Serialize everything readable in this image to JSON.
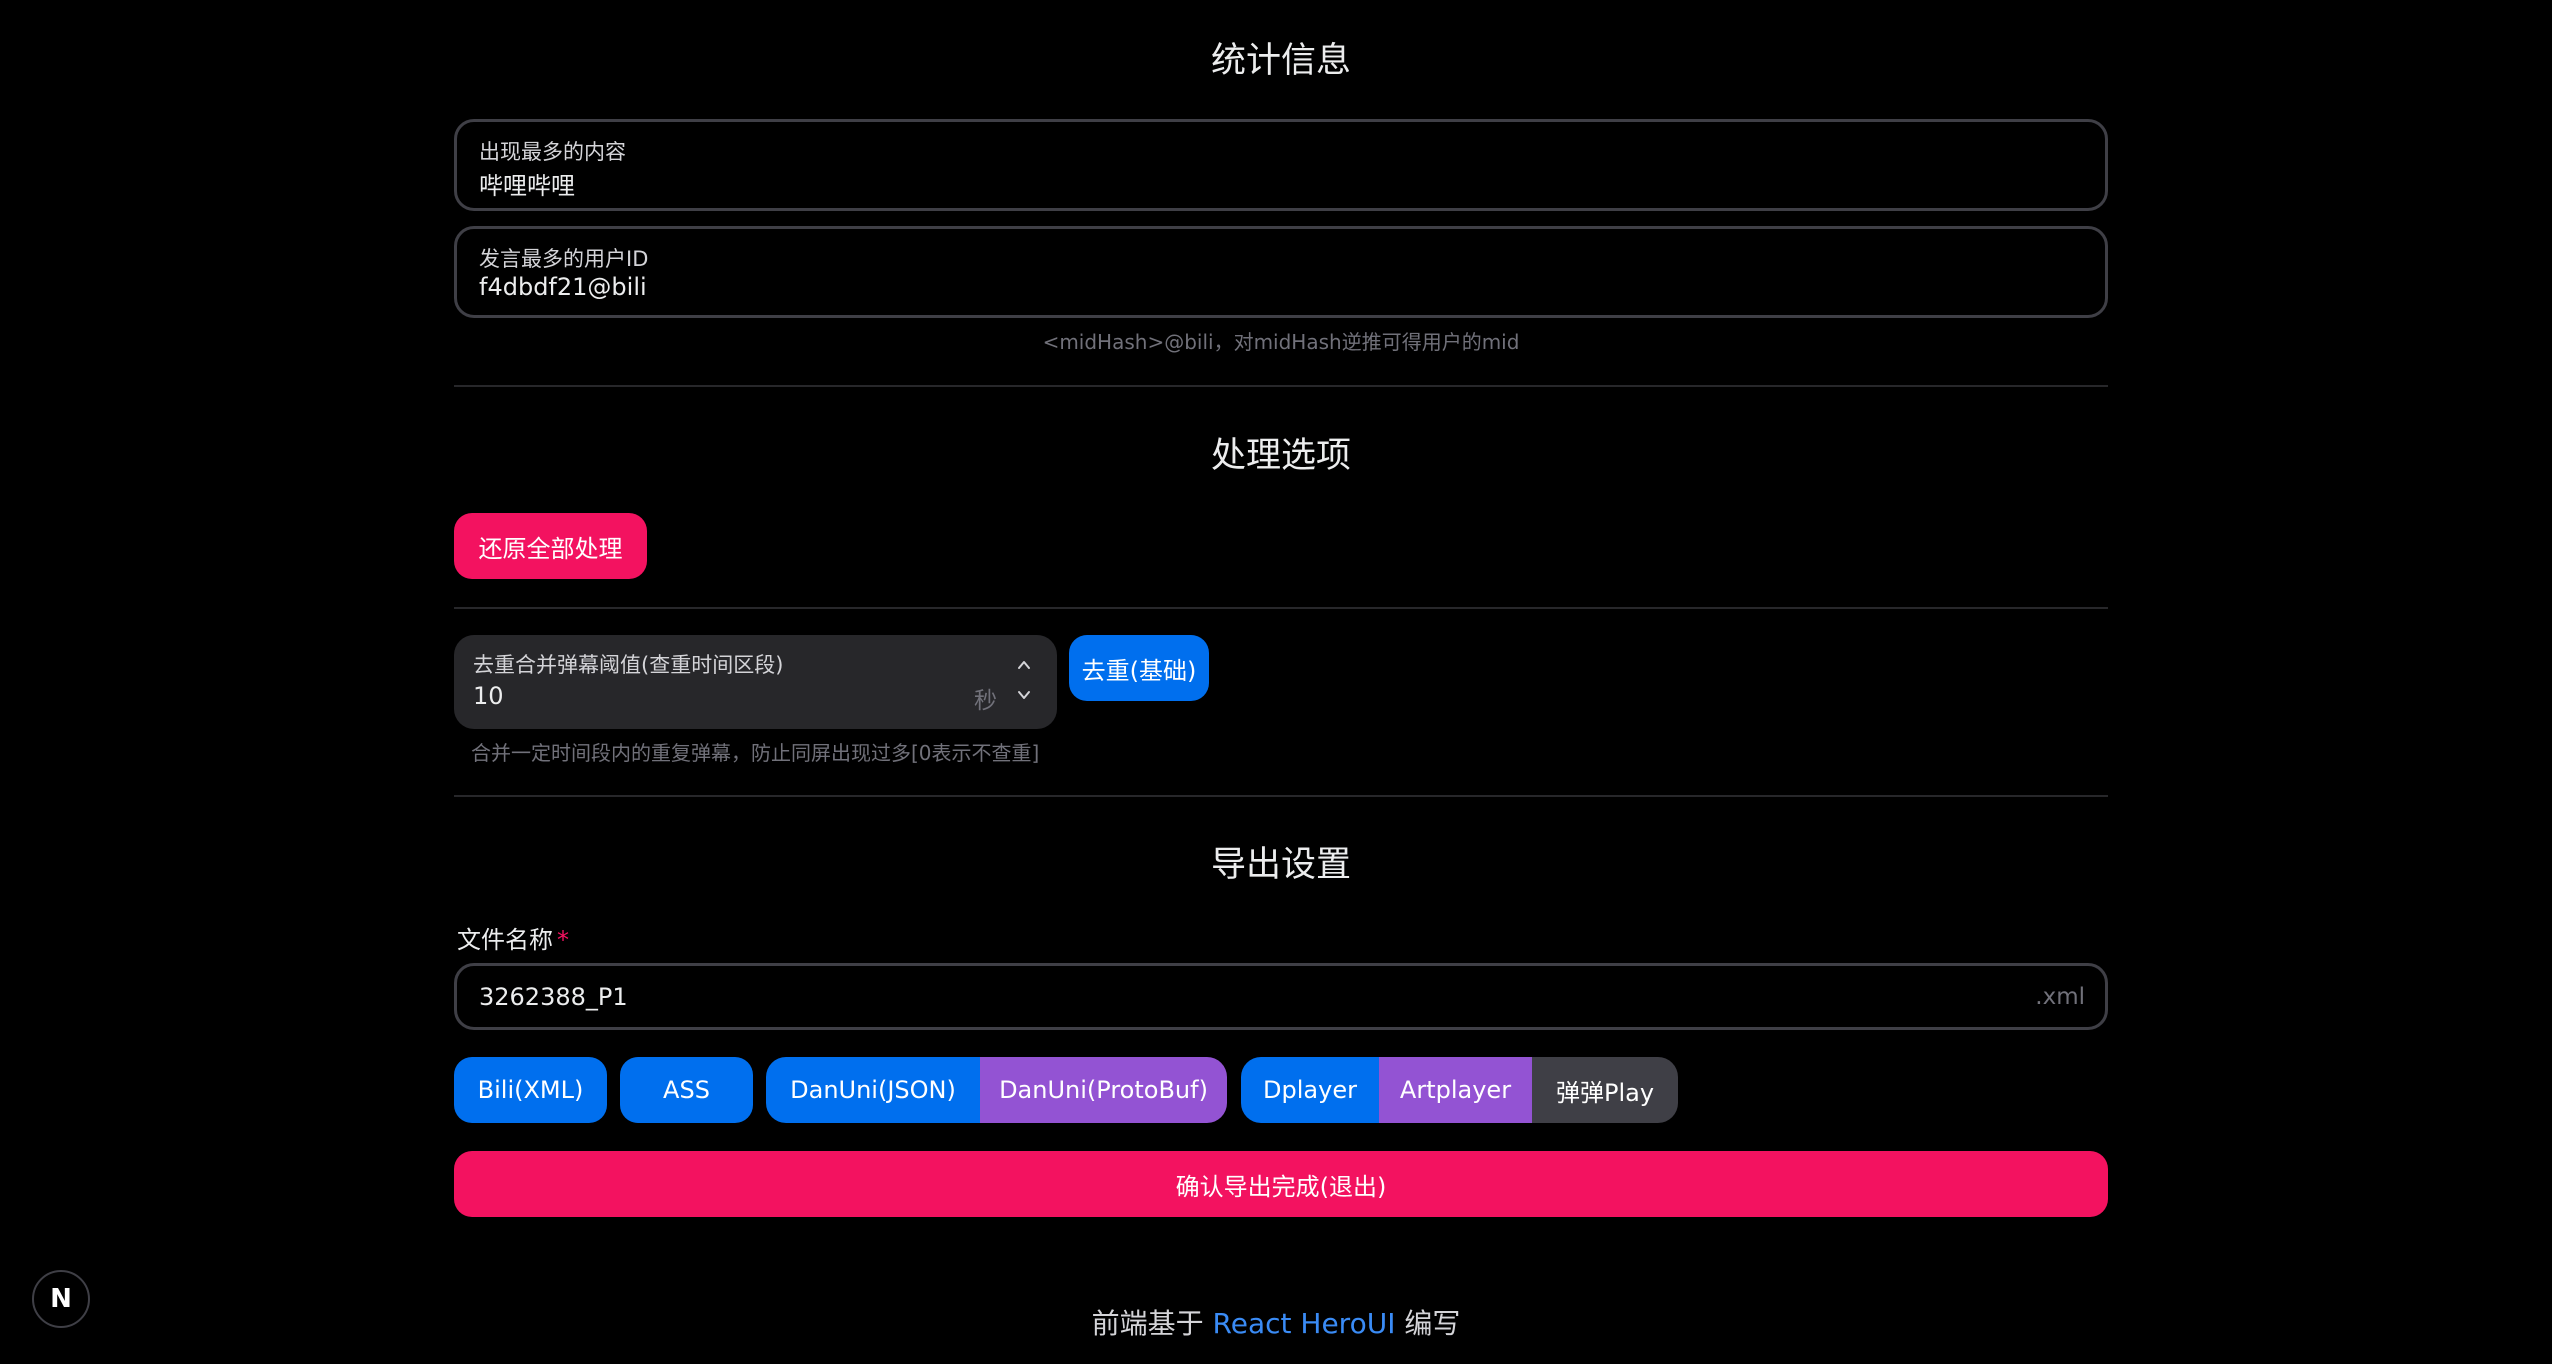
{
  "stats": {
    "title": "统计信息",
    "most_content": {
      "label": "出现最多的内容",
      "value": "哔哩哔哩"
    },
    "most_user": {
      "label": "发言最多的用户ID",
      "value": "f4dbdf21@bili"
    },
    "user_desc": "<midHash>@bili，对midHash逆推可得用户的mid"
  },
  "processing": {
    "title": "处理选项",
    "restore_button": "还原全部处理",
    "dedup": {
      "label": "去重合并弹幕阈值(查重时间区段)",
      "value": "10",
      "suffix": "秒",
      "button": "去重(基础)",
      "description": "合并一定时间段内的重复弹幕，防止同屏出现过多[0表示不查重]"
    }
  },
  "export": {
    "title": "导出设置",
    "filename_label": "文件名称",
    "required_mark": "*",
    "filename_value": "3262388_P1",
    "filename_suffix": ".xml",
    "formats": {
      "bili_xml": "Bili(XML)",
      "ass": "ASS",
      "danuni_json": "DanUni(JSON)",
      "danuni_protobuf": "DanUni(ProtoBuf)",
      "dplayer": "Dplayer",
      "artplayer": "Artplayer",
      "danmaku_play": "弹弹Play"
    },
    "confirm_button": "确认导出完成(退出)"
  },
  "footer": {
    "prefix": "前端基于",
    "link": "React HeroUI",
    "suffix": "编写"
  },
  "badge": {
    "letter": "N"
  },
  "colors": {
    "pink": "#f31260",
    "blue": "#006FEE",
    "purple": "#9353d3",
    "gray": "#3f3f46",
    "link": "#3a8bf5"
  }
}
